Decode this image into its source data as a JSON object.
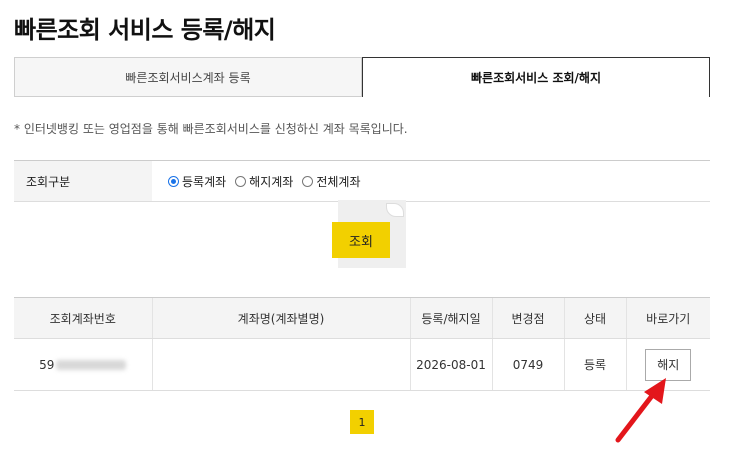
{
  "header": {
    "title": "빠른조회 서비스 등록/해지"
  },
  "tabs": [
    {
      "label": "빠른조회서비스계좌 등록"
    },
    {
      "label": "빠른조회서비스 조회/해지"
    }
  ],
  "notice": "* 인터넷뱅킹 또는 영업점을 통해 빠른조회서비스를 신청하신 계좌 목록입니다.",
  "filter": {
    "label": "조회구분",
    "options": [
      "등록계좌",
      "해지계좌",
      "전체계좌"
    ],
    "selected": "등록계좌"
  },
  "search_button": "조회",
  "table": {
    "headers": [
      "조회계좌번호",
      "계좌명(계좌별명)",
      "등록/해지일",
      "변경점",
      "상태",
      "바로가기"
    ],
    "rows": [
      {
        "account_prefix": "59",
        "account_name": "",
        "date": "2026-08-01",
        "branch": "0749",
        "status": "등록",
        "action": "해지"
      }
    ]
  },
  "pagination": {
    "current": "1"
  },
  "colors": {
    "accent": "#f2d000",
    "arrow": "#e3161b",
    "radio": "#1a73e8"
  }
}
